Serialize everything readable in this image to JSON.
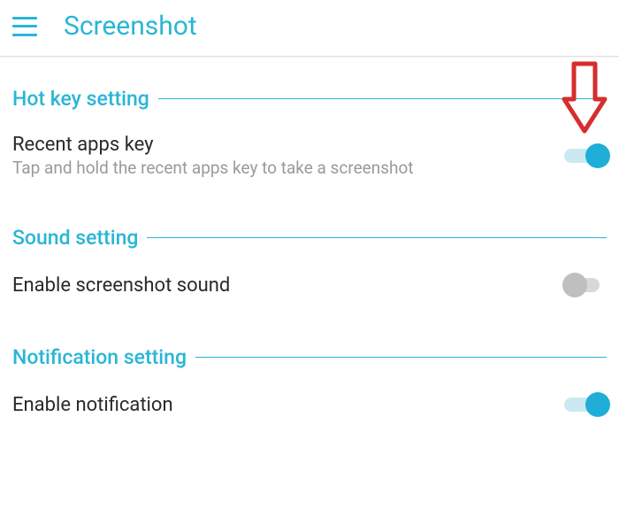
{
  "header": {
    "title": "Screenshot"
  },
  "sections": {
    "hotkey": {
      "title": "Hot key setting",
      "item": {
        "label": "Recent apps key",
        "description": "Tap and hold the recent apps key to take a screenshot",
        "enabled": true
      }
    },
    "sound": {
      "title": "Sound setting",
      "item": {
        "label": "Enable screenshot sound",
        "enabled": false
      }
    },
    "notification": {
      "title": "Notification setting",
      "item": {
        "label": "Enable notification",
        "enabled": true
      }
    }
  },
  "colors": {
    "accent": "#29b6d6",
    "annotation": "#d62e2e"
  }
}
